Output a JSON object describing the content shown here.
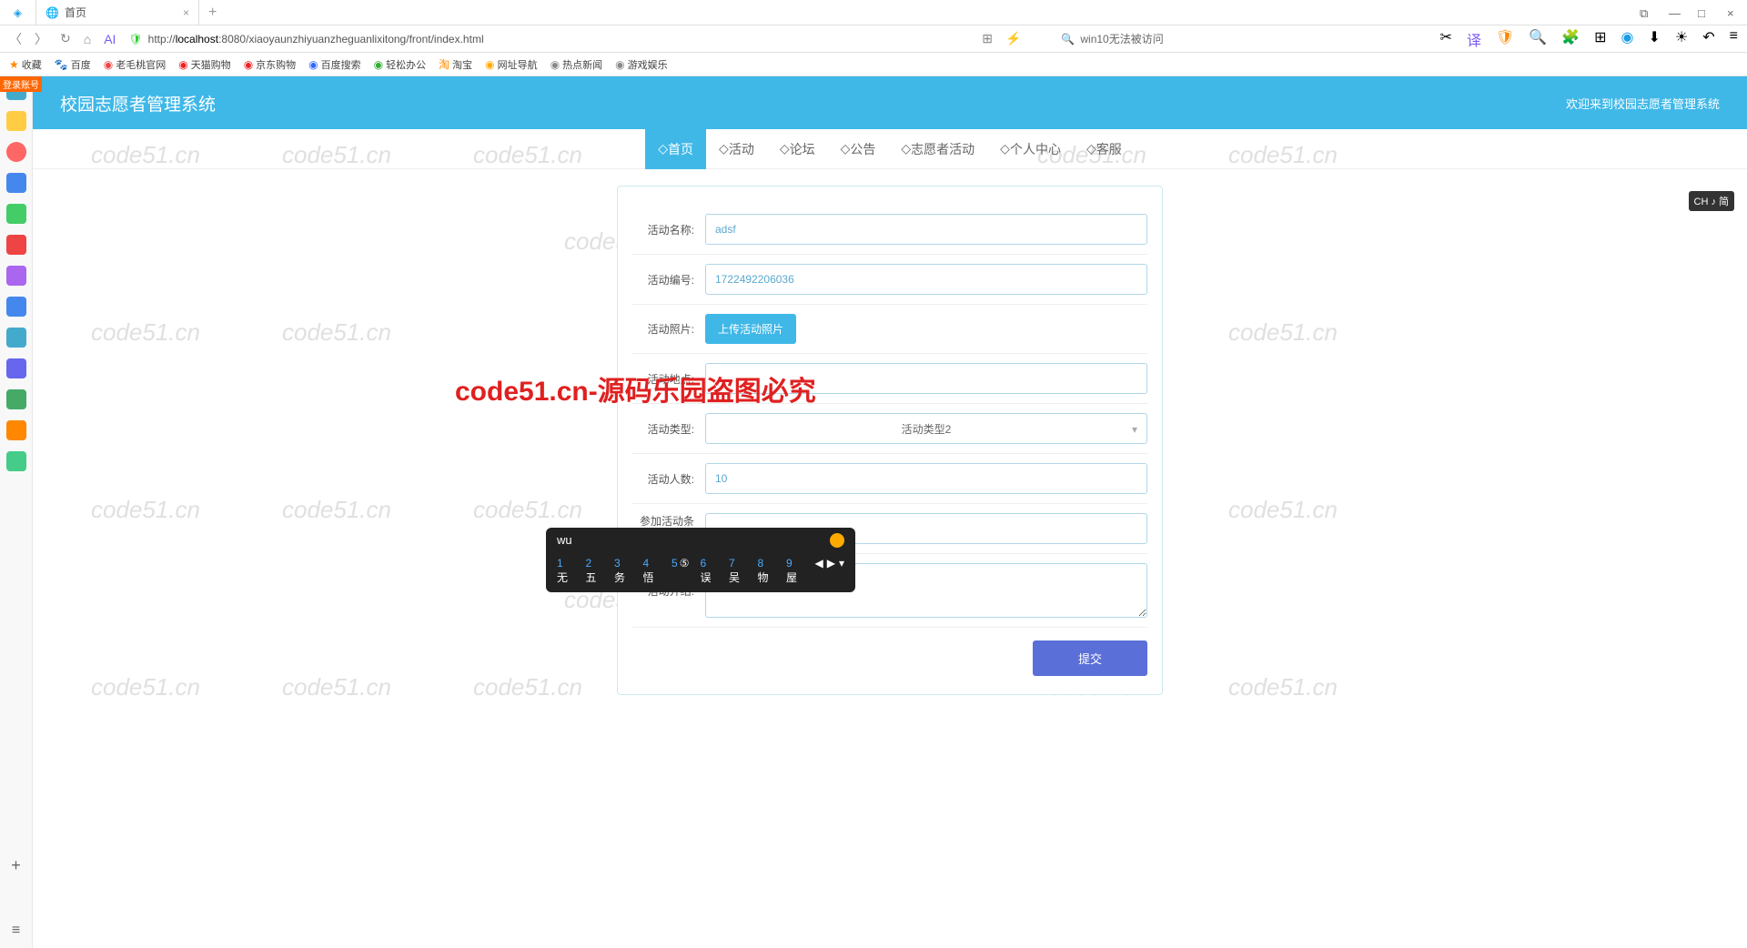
{
  "browser": {
    "tab_title": "首页",
    "url_prefix": "http://",
    "url_host": "localhost",
    "url_path": ":8080/xiaoyaunzhiyuanzheguanlixitong/front/index.html",
    "search_text": "win10无法被访问"
  },
  "bookmarks": [
    "收藏",
    "百度",
    "老毛桃官网",
    "天猫购物",
    "京东购物",
    "百度搜索",
    "轻松办公",
    "淘宝",
    "网址导航",
    "热点新闻",
    "游戏娱乐"
  ],
  "header": {
    "title": "校园志愿者管理系统",
    "welcome": "欢迎来到校园志愿者管理系统"
  },
  "nav": [
    "首页",
    "活动",
    "论坛",
    "公告",
    "志愿者活动",
    "个人中心",
    "客服"
  ],
  "form": {
    "name_label": "活动名称:",
    "name_value": "adsf",
    "num_label": "活动编号:",
    "num_value": "1722492206036",
    "photo_label": "活动照片:",
    "upload_btn": "上传活动照片",
    "addr_label": "活动地点:",
    "addr_value": "",
    "type_label": "活动类型:",
    "type_value": "活动类型2",
    "count_label": "活动人数:",
    "count_value": "10",
    "cond_label": "参加活动条件:",
    "cond_value": "",
    "intro_label": "活动介绍:",
    "intro_value": "",
    "submit": "提交"
  },
  "ime": {
    "input": "wu",
    "candidates": [
      {
        "n": "1",
        "c": "无"
      },
      {
        "n": "2",
        "c": "五"
      },
      {
        "n": "3",
        "c": "务"
      },
      {
        "n": "4",
        "c": "悟"
      },
      {
        "n": "5",
        "c": "⑤"
      },
      {
        "n": "6",
        "c": "误"
      },
      {
        "n": "7",
        "c": "吴"
      },
      {
        "n": "8",
        "c": "物"
      },
      {
        "n": "9",
        "c": "屋"
      }
    ]
  },
  "ime_badge": "CH ♪ 简",
  "watermark_red": "code51.cn-源码乐园盗图必究",
  "login_badge": "登录账号"
}
